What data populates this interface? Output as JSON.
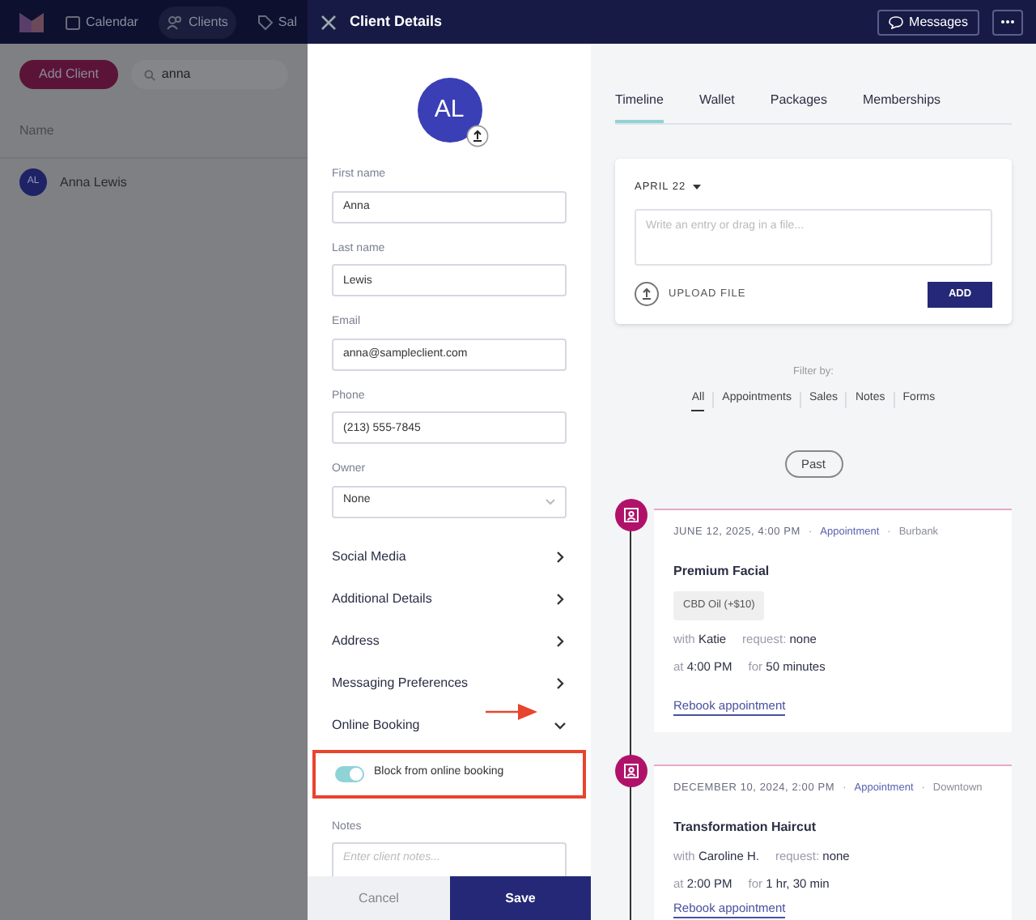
{
  "background_app": {
    "nav": [
      {
        "label": "Calendar",
        "selected": false
      },
      {
        "label": "Clients",
        "selected": true
      },
      {
        "label": "Sal",
        "selected": false
      }
    ],
    "add_button": "Add Client",
    "search": {
      "value": "anna"
    },
    "table": {
      "columns": [
        "Name"
      ],
      "rows": [
        {
          "initials": "AL",
          "name": "Anna Lewis"
        }
      ]
    }
  },
  "drawer": {
    "title": "Client Details",
    "messages_button": "Messages",
    "avatar": {
      "initials": "AL"
    },
    "fields": [
      {
        "kind": "text",
        "label": "First name",
        "value": "Anna"
      },
      {
        "kind": "text",
        "label": "Last name",
        "value": "Lewis"
      },
      {
        "kind": "text",
        "label": "Email",
        "value": "anna@sampleclient.com"
      },
      {
        "kind": "text",
        "label": "Phone",
        "value": "(213) 555-7845"
      },
      {
        "kind": "select",
        "label": "Owner",
        "value": "None"
      }
    ],
    "sections": [
      {
        "label": "Social Media",
        "expanded": false
      },
      {
        "label": "Additional Details",
        "expanded": false
      },
      {
        "label": "Address",
        "expanded": false
      },
      {
        "label": "Messaging Preferences",
        "expanded": false
      },
      {
        "label": "Online Booking",
        "expanded": true
      }
    ],
    "toggle": {
      "label": "Block from online booking",
      "on": true
    },
    "notes": {
      "label": "Notes",
      "placeholder": "Enter client notes..."
    },
    "footer": {
      "cancel": "Cancel",
      "save": "Save"
    },
    "tabs": [
      {
        "label": "Timeline",
        "selected": true
      },
      {
        "label": "Wallet",
        "selected": false
      },
      {
        "label": "Packages",
        "selected": false
      },
      {
        "label": "Memberships",
        "selected": false
      }
    ],
    "composer": {
      "date": "APRIL 22",
      "placeholder": "Write an entry or drag in a file...",
      "upload": "UPLOAD FILE",
      "add": "ADD"
    },
    "filter": {
      "label": "Filter by:",
      "options": [
        {
          "label": "All",
          "selected": true
        },
        {
          "label": "Appointments",
          "selected": false
        },
        {
          "label": "Sales",
          "selected": false
        },
        {
          "label": "Notes",
          "selected": false
        },
        {
          "label": "Forms",
          "selected": false
        }
      ]
    },
    "past_button": "Past",
    "timeline": [
      {
        "date": "JUNE 12, 2025, 4:00 PM",
        "separator": "·",
        "type": "Appointment",
        "location": "Burbank",
        "service": "Premium Facial",
        "addons": [
          "CBD Oil (+$10)"
        ],
        "details": [
          [
            {
              "label": "with",
              "value": "Katie"
            },
            {
              "label": "request:",
              "value": "none"
            }
          ],
          [
            {
              "label": "at",
              "value": "4:00 PM"
            },
            {
              "label": "for",
              "value": "50 minutes"
            }
          ]
        ],
        "link": "Rebook appointment"
      },
      {
        "date": "DECEMBER 10, 2024, 2:00 PM",
        "separator": "·",
        "type": "Appointment",
        "location": "Downtown",
        "service": "Transformation Haircut",
        "details": [
          [
            {
              "label": "with",
              "value": "Caroline H."
            },
            {
              "label": "request:",
              "value": "none"
            }
          ],
          [
            {
              "label": "at",
              "value": "2:00 PM"
            },
            {
              "label": "for",
              "value": "1 hr, 30 min"
            }
          ]
        ],
        "link": "Rebook appointment"
      }
    ]
  }
}
